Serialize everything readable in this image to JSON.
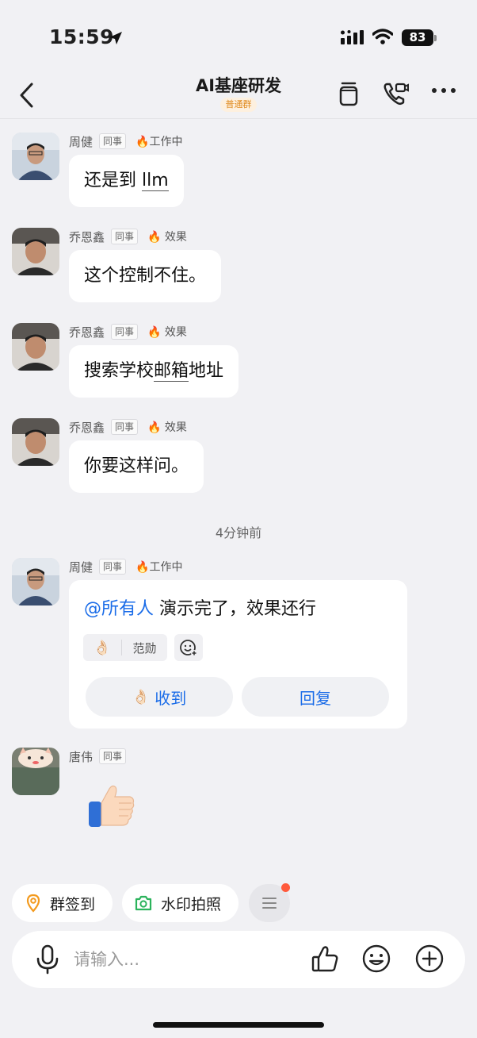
{
  "status_bar": {
    "time": "15:59",
    "battery": "83"
  },
  "nav": {
    "title": "AI基座研发",
    "badge": "普通群"
  },
  "messages": [
    {
      "sender": "周健",
      "tag": "同事",
      "status": "🔥工作中",
      "text_plain": "还是到 ",
      "text_underlined": "llm",
      "text_after": ""
    },
    {
      "sender": "乔恩鑫",
      "tag": "同事",
      "status": "🔥 效果",
      "text_plain": "这个控制不住。"
    },
    {
      "sender": "乔恩鑫",
      "tag": "同事",
      "status": "🔥 效果",
      "text_plain": "搜索学校",
      "text_underlined": "邮箱",
      "text_after": "地址"
    },
    {
      "sender": "乔恩鑫",
      "tag": "同事",
      "status": "🔥 效果",
      "text_plain": "你要这样问。"
    }
  ],
  "time_divider": "4分钟前",
  "card_message": {
    "sender": "周健",
    "tag": "同事",
    "status": "🔥工作中",
    "mention": "@所有人",
    "text": " 演示完了，效果还行",
    "reaction_emoji": "👌🏻",
    "reaction_name": "范勋",
    "btn_received": "收到",
    "btn_received_emoji": "👌🏻",
    "btn_reply": "回复"
  },
  "last_message": {
    "sender": "唐伟",
    "tag": "同事",
    "sticker": "thumbs-up"
  },
  "quick_actions": [
    {
      "label": "群签到",
      "icon": "location-pin-icon",
      "color": "#f39a1e"
    },
    {
      "label": "水印拍照",
      "icon": "camera-icon",
      "color": "#2bb35c"
    }
  ],
  "input": {
    "placeholder": "请输入..."
  },
  "colors": {
    "accent": "#1a6ce8",
    "badge": "#e08a1e",
    "dot": "#ff5a3c"
  }
}
